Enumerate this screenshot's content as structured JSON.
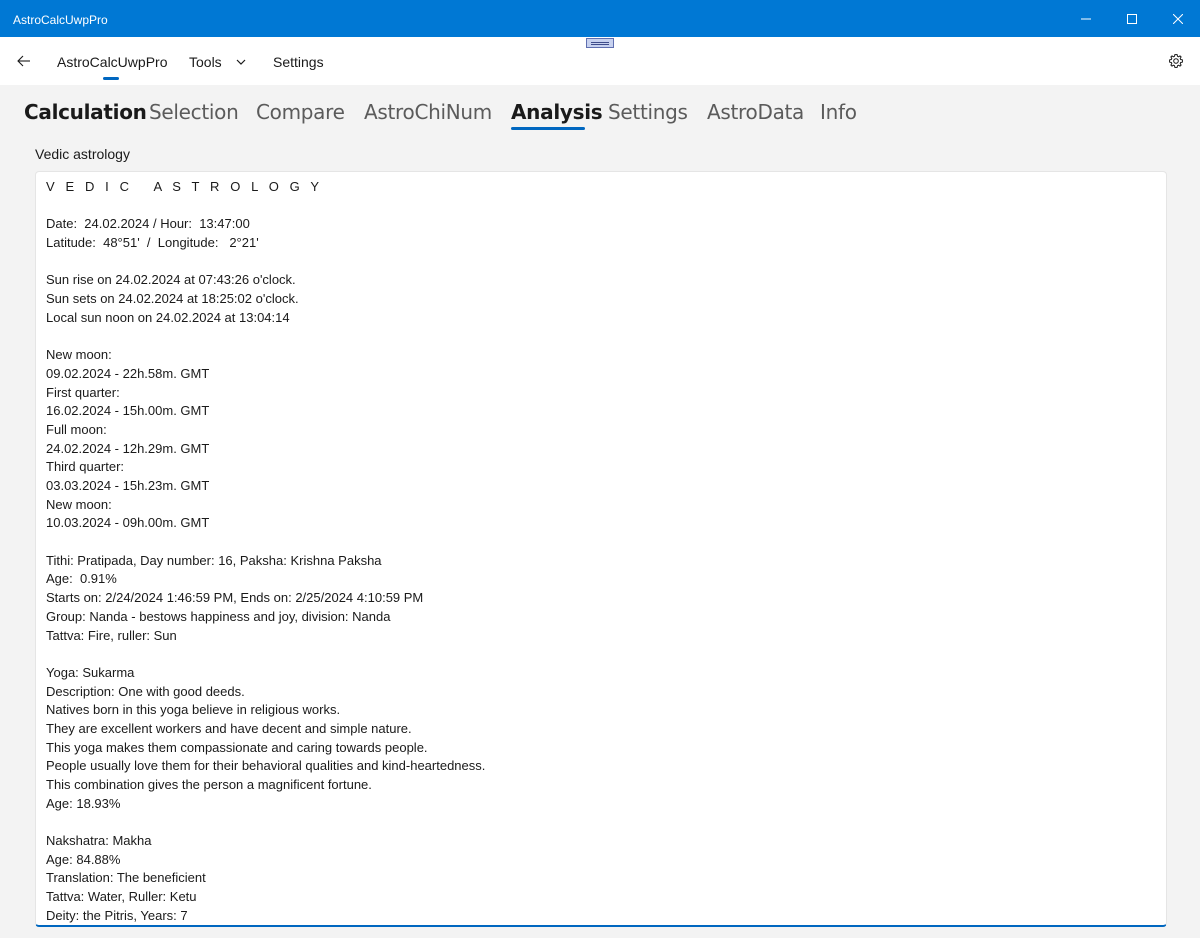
{
  "window": {
    "title": "AstroCalcUwpPro"
  },
  "navbar": {
    "items": [
      {
        "label": "AstroCalcUwpPro",
        "icon": ""
      },
      {
        "label": "Tools",
        "icon": "chevron-down-icon"
      },
      {
        "label": "Settings",
        "icon": ""
      }
    ],
    "selected": "AstroCalcUwpPro",
    "back_icon": "back-arrow-icon",
    "settings_icon": "gear-icon",
    "accent_color": "#0067c0"
  },
  "tabs": [
    {
      "label": "Calculation"
    },
    {
      "label": "Selection"
    },
    {
      "label": "Compare"
    },
    {
      "label": "AstroChiNum"
    },
    {
      "label": "Analysis"
    },
    {
      "label": "Settings"
    },
    {
      "label": "AstroData"
    },
    {
      "label": "Info"
    }
  ],
  "selected_tab": "Analysis",
  "main": {
    "section_label": "Vedic astrology",
    "lines": [
      "V E D I C   A S T R O L O G Y",
      "",
      "Date:  24.02.2024 / Hour:  13:47:00",
      "Latitude:  48°51'  /  Longitude:   2°21'",
      "",
      "Sun rise on 24.02.2024 at 07:43:26 o'clock.",
      "Sun sets on 24.02.2024 at 18:25:02 o'clock.",
      "Local sun noon on 24.02.2024 at 13:04:14",
      "",
      "New moon:",
      "09.02.2024 - 22h.58m. GMT",
      "First quarter:",
      "16.02.2024 - 15h.00m. GMT",
      "Full moon:",
      "24.02.2024 - 12h.29m. GMT",
      "Third quarter:",
      "03.03.2024 - 15h.23m. GMT",
      "New moon:",
      "10.03.2024 - 09h.00m. GMT",
      "",
      "Tithi: Pratipada, Day number: 16, Paksha: Krishna Paksha",
      "Age:  0.91%",
      "Starts on: 2/24/2024 1:46:59 PM, Ends on: 2/25/2024 4:10:59 PM",
      "Group: Nanda - bestows happiness and joy, division: Nanda",
      "Tattva: Fire, ruller: Sun",
      "",
      "Yoga: Sukarma",
      "Description: One with good deeds.",
      "Natives born in this yoga believe in religious works.",
      "They are excellent workers and have decent and simple nature.",
      "This yoga makes them compassionate and caring towards people.",
      "People usually love them for their behavioral qualities and kind-heartedness.",
      "This combination gives the person a magnificent fortune.",
      "Age: 18.93%",
      "",
      "Nakshatra: Makha",
      "Age: 84.88%",
      "Translation: The beneficient",
      "Tattva: Water, Ruller: Ketu",
      "Deity: the Pitris, Years: 7"
    ]
  }
}
